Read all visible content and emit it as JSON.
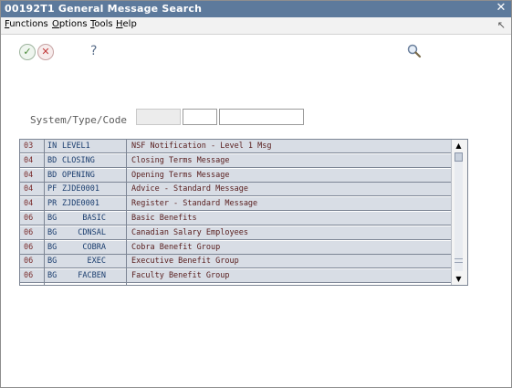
{
  "window": {
    "title": "00192T1   General Message Search"
  },
  "menu": {
    "items": [
      {
        "label": "Functions",
        "u": "F",
        "rest": "unctions"
      },
      {
        "label": "Options",
        "u": "O",
        "rest": "ptions"
      },
      {
        "label": "Tools",
        "u": "T",
        "rest": "ools"
      },
      {
        "label": "Help",
        "u": "H",
        "rest": "elp"
      }
    ]
  },
  "toolbar": {
    "ok_icon": "checkmark-icon",
    "cancel_icon": "x-icon",
    "help_label": "?",
    "find_icon": "magnifier-icon"
  },
  "search": {
    "label": "System/Type/Code",
    "system_value": "",
    "type_value": "",
    "code_value": ""
  },
  "grid": {
    "rows": [
      {
        "system": "03",
        "type": "IN",
        "code": "LEVEL1",
        "description": "NSF Notification - Level 1 Msg",
        "align": "left"
      },
      {
        "system": "04",
        "type": "BD",
        "code": "CLOSING",
        "description": "Closing Terms Message",
        "align": "left"
      },
      {
        "system": "04",
        "type": "BD",
        "code": "OPENING",
        "description": "Opening Terms Message",
        "align": "left"
      },
      {
        "system": "04",
        "type": "PF",
        "code": "ZJDE0001",
        "description": "Advice - Standard Message",
        "align": "left"
      },
      {
        "system": "04",
        "type": "PR",
        "code": "ZJDE0001",
        "description": "Register - Standard Message",
        "align": "left"
      },
      {
        "system": "06",
        "type": "BG",
        "code": "BASIC",
        "description": "Basic Benefits",
        "align": "right"
      },
      {
        "system": "06",
        "type": "BG",
        "code": "CDNSAL",
        "description": "Canadian Salary Employees",
        "align": "right"
      },
      {
        "system": "06",
        "type": "BG",
        "code": "COBRA",
        "description": "Cobra Benefit Group",
        "align": "right"
      },
      {
        "system": "06",
        "type": "BG",
        "code": "EXEC",
        "description": "Executive Benefit Group",
        "align": "right"
      },
      {
        "system": "06",
        "type": "BG",
        "code": "FACBEN",
        "description": "Faculty Benefit Group",
        "align": "right"
      }
    ]
  },
  "colors": {
    "titlebar": "#5d7a9c",
    "row_background": "#d8dde5"
  }
}
